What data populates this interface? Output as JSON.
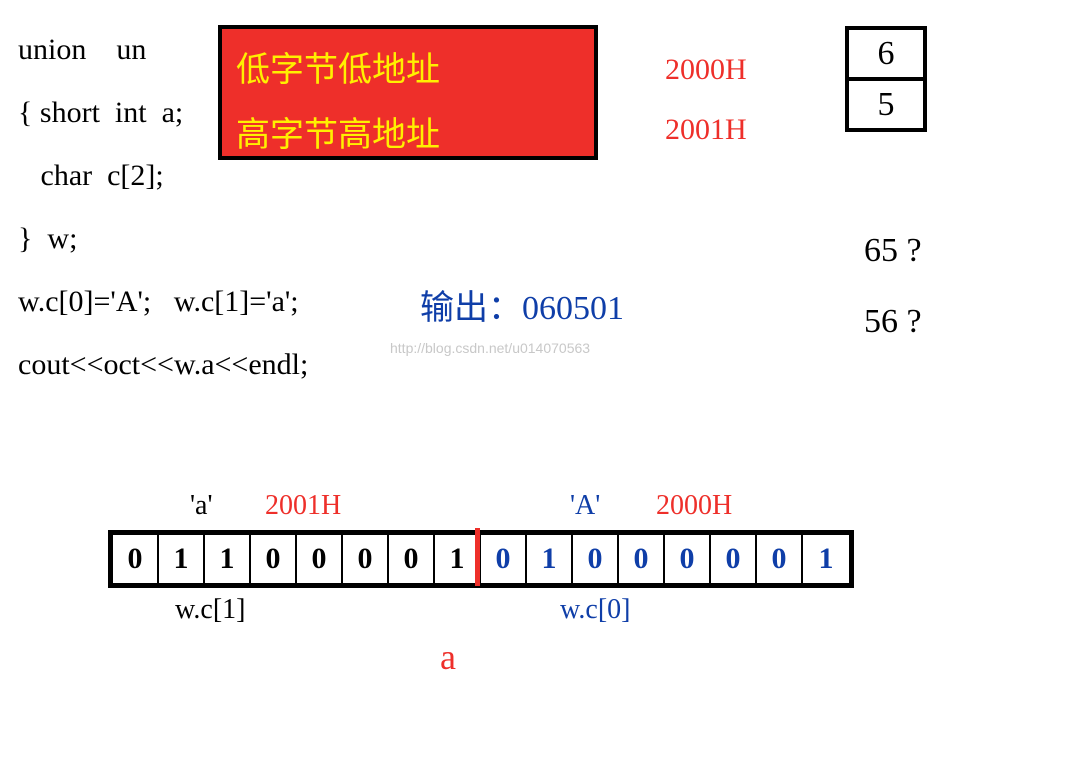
{
  "code": {
    "line1": "union    un",
    "line2": "{ short  int  a;",
    "line3": "   char  c[2];",
    "line4": "}  w;",
    "line5": "w.c[0]='A';   w.c[1]='a';",
    "line6": "cout<<oct<<w.a<<endl;"
  },
  "redBox": {
    "line1": "低字节低地址",
    "line2": "高字节高地址"
  },
  "addresses": {
    "addr0": "2000H",
    "addr1": "2001H"
  },
  "memCells": {
    "cell0": "6",
    "cell1": "5"
  },
  "questions": {
    "q1": "65 ?",
    "q2": "56 ?"
  },
  "output": {
    "label": "输出：",
    "value": "060501"
  },
  "watermark": "http://blog.csdn.net/u014070563",
  "bitLabels": {
    "charA1": "'a'",
    "addr1": "2001H",
    "charA0": "'A'",
    "addr0": "2000H"
  },
  "bits": {
    "high": [
      "0",
      "1",
      "1",
      "0",
      "0",
      "0",
      "0",
      "1"
    ],
    "low": [
      "0",
      "1",
      "0",
      "0",
      "0",
      "0",
      "0",
      "1"
    ]
  },
  "wcLabels": {
    "wc1": "w.c[1]",
    "wc0": "w.c[0]"
  },
  "bottomLabel": "a",
  "chart_data": {
    "type": "table",
    "title": "Union memory layout (little-endian)",
    "addresses": [
      {
        "address": "2000H",
        "octal_digit": "6",
        "char": "A",
        "binary": "01000001",
        "member": "w.c[0]"
      },
      {
        "address": "2001H",
        "octal_digit": "5",
        "char": "a",
        "binary": "01100001",
        "member": "w.c[1]"
      }
    ],
    "combined_octal_output": "060501",
    "union_name": "w",
    "field_a_type": "short int",
    "field_c_type": "char[2]",
    "endianness_rule": [
      "低字节低地址",
      "高字节高地址"
    ],
    "candidate_outputs": [
      "65",
      "56"
    ]
  }
}
